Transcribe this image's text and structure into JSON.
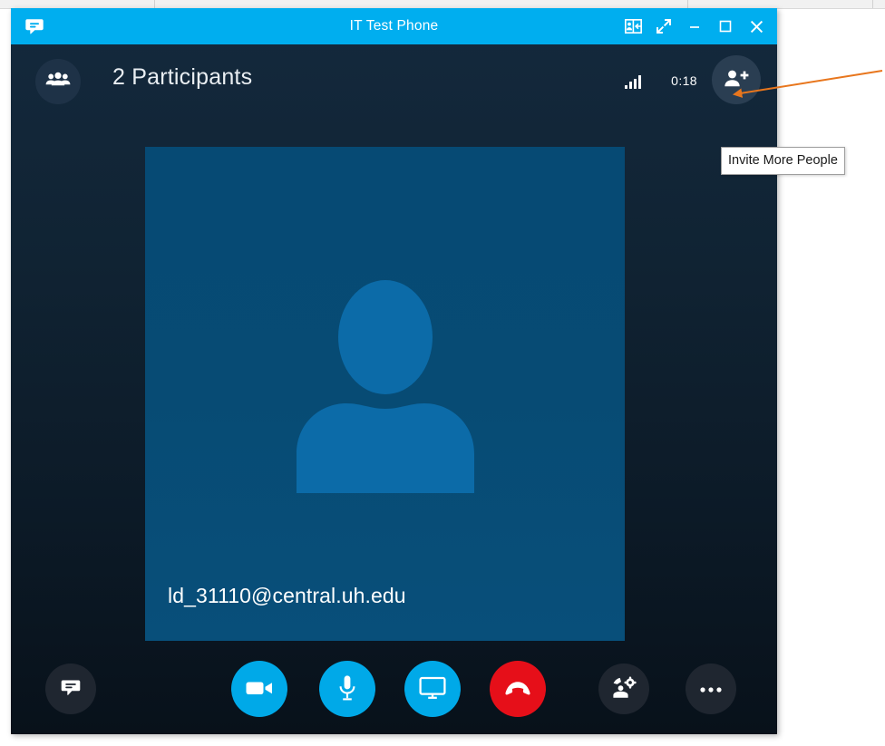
{
  "window": {
    "title": "IT Test Phone",
    "app_icon": "skype-chat-bubble-icon",
    "titlebar_buttons": [
      {
        "name": "dock-contact-card",
        "icon": "contact-card-icon",
        "label": ""
      },
      {
        "name": "full-screen",
        "icon": "expand-arrows-icon",
        "label": ""
      },
      {
        "name": "minimize",
        "icon": "minimize-icon",
        "label": ""
      },
      {
        "name": "maximize",
        "icon": "maximize-icon",
        "label": ""
      },
      {
        "name": "close",
        "icon": "close-icon",
        "label": ""
      }
    ]
  },
  "background_window": {
    "ghost_text": ""
  },
  "call_header": {
    "participants_icon": "people-group-icon",
    "participants_label": "2 Participants",
    "participant_count": 2,
    "signal_icon": "signal-bars-icon",
    "signal_bars": 4,
    "call_duration": "0:18",
    "invite_icon": "person-plus-icon"
  },
  "video_stage": {
    "avatar_icon": "person-silhouette-icon",
    "participant_name": "ld_31110@central.uh.edu"
  },
  "toolbar": {
    "chat_label": "",
    "chat_icon": "chat-bubble-icon",
    "video_label": "",
    "video_icon": "video-camera-icon",
    "mic_label": "",
    "mic_icon": "microphone-icon",
    "share_label": "",
    "share_icon": "monitor-screen-share-icon",
    "hangup_label": "",
    "hangup_icon": "hang-up-phone-icon",
    "devices_label": "",
    "devices_icon": "call-settings-gear-icon",
    "more_label": "",
    "more_icon": "ellipsis-icon"
  },
  "tooltip": {
    "text": "Invite More People"
  },
  "annotation": {
    "arrow_color": "#E8761D",
    "target": "invite-button"
  },
  "colors": {
    "titlebar_blue": "#00AEEF",
    "accent_blue": "#00A9E8",
    "hangup_red": "#E60F19",
    "window_bg_top": "#14293d",
    "window_bg_bottom": "#08111a",
    "video_bg": "#074b74",
    "avatar_fill": "#0c6ba8",
    "button_dark": "#1f2630",
    "annotation_orange": "#E8761D"
  }
}
